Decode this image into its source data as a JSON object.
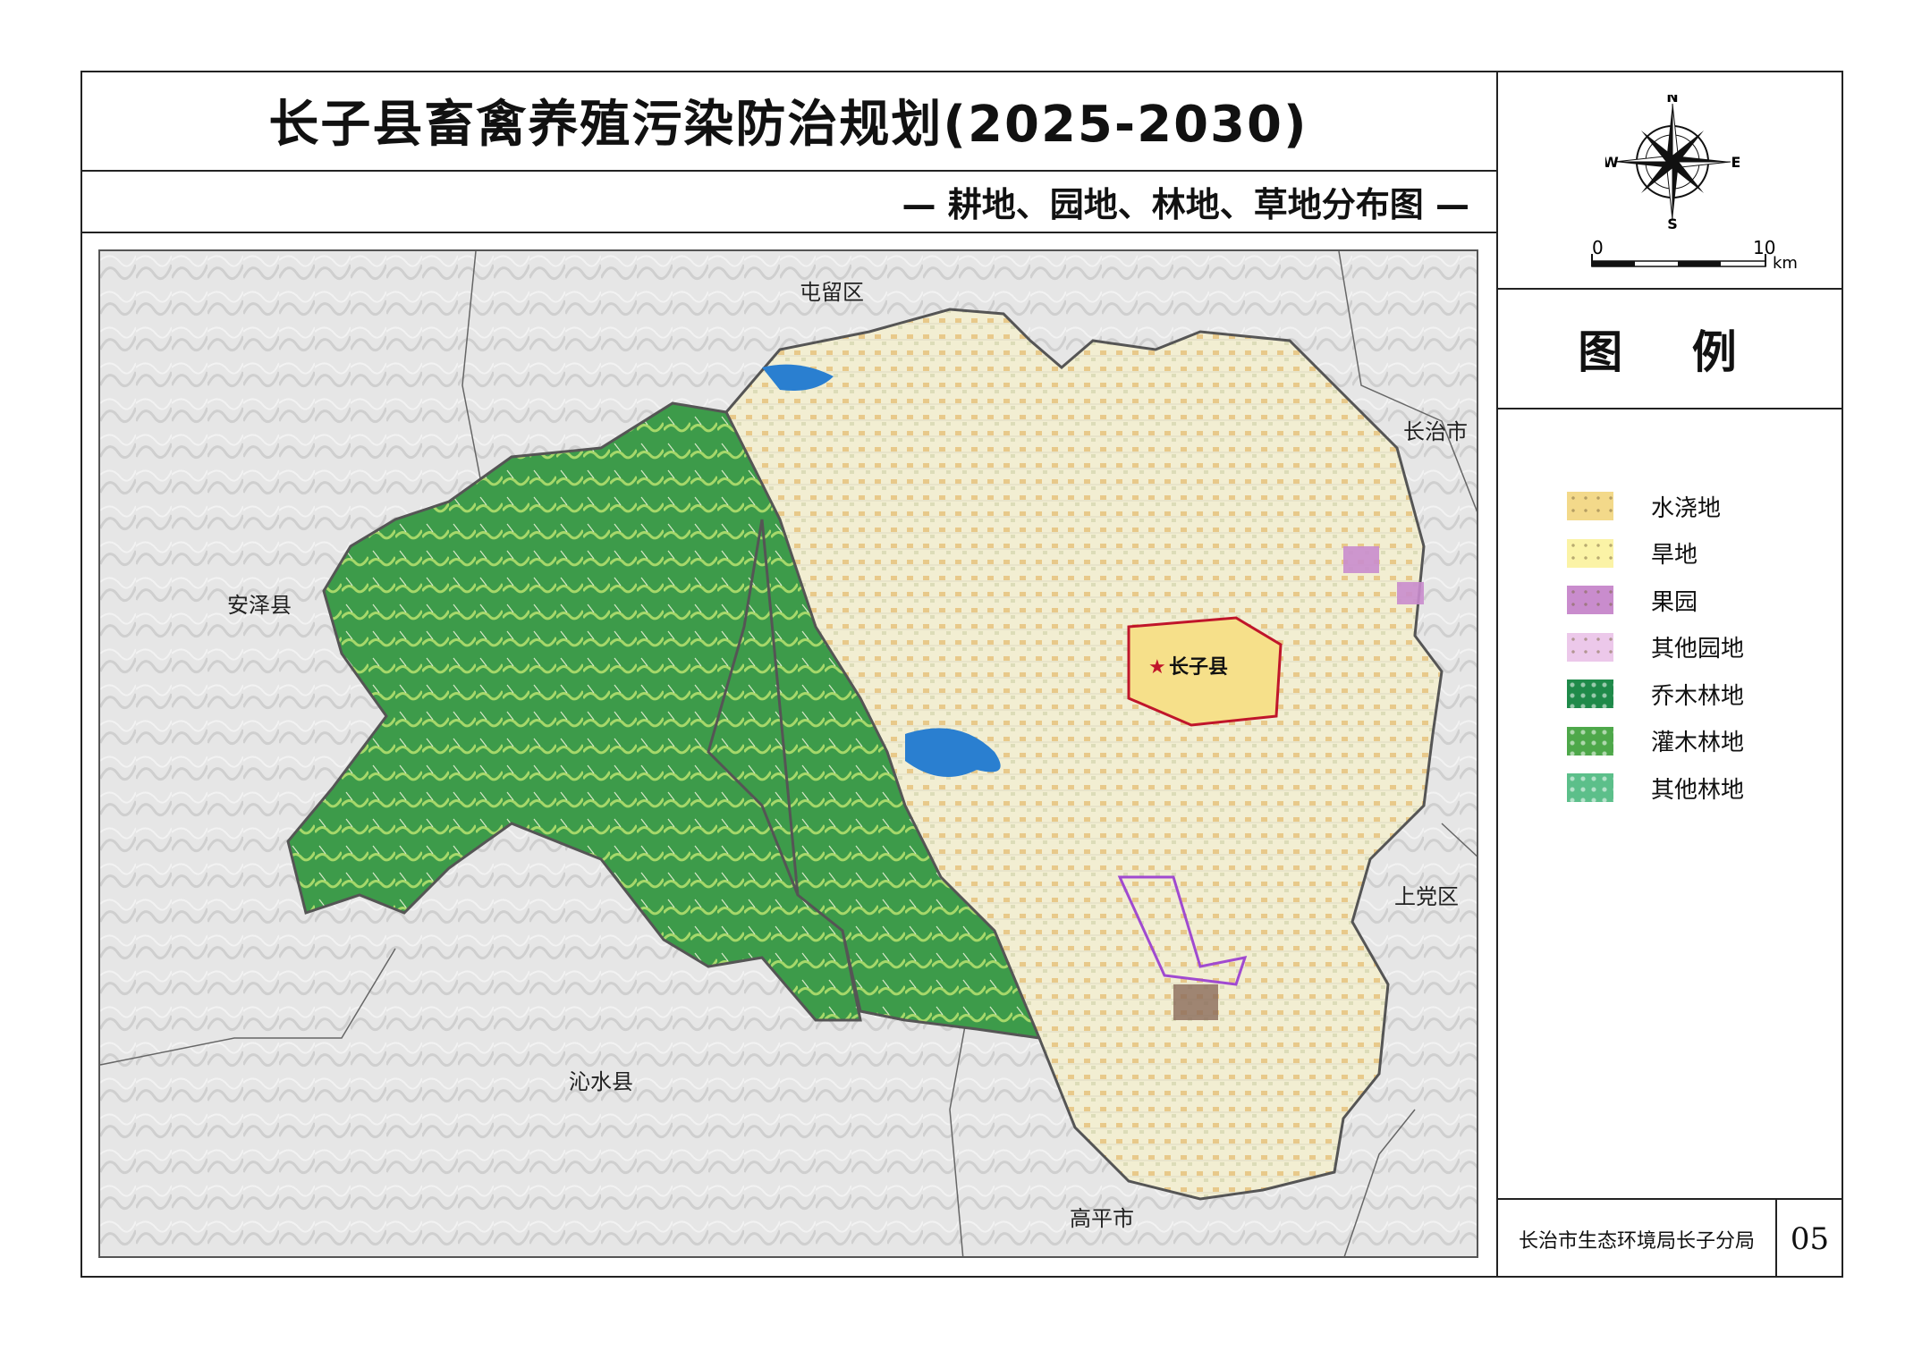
{
  "header": {
    "title": "长子县畜禽养殖污染防治规划(2025-2030)",
    "subtitle": "— 耕地、园地、林地、草地分布图 —"
  },
  "compass": {
    "n": "N",
    "s": "S",
    "e": "E",
    "w": "W"
  },
  "scale_bar": {
    "start": "0",
    "end": "10",
    "unit": "km"
  },
  "legend": {
    "title": "图 例",
    "items": [
      {
        "label": "水浇地",
        "color": "#f3d98a"
      },
      {
        "label": "旱地",
        "color": "#fbf3a6"
      },
      {
        "label": "果园",
        "color": "#c98ccd"
      },
      {
        "label": "其他园地",
        "color": "#ecc8ea"
      },
      {
        "label": "乔木林地",
        "color": "#1f8a4a"
      },
      {
        "label": "灌木林地",
        "color": "#4ea84a"
      },
      {
        "label": "其他林地",
        "color": "#5cbf8a"
      }
    ]
  },
  "map": {
    "regions": [
      "屯留区",
      "长治市",
      "安泽县",
      "上党区",
      "沁水县",
      "高平市"
    ],
    "county": "长子县"
  },
  "footer": {
    "org": "长治市生态环境局长子分局",
    "page": "05"
  }
}
